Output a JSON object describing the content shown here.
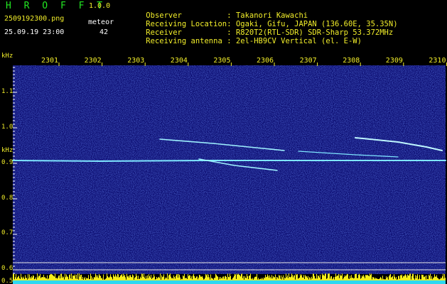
{
  "header": {
    "title": "H R O F F T",
    "version": "1.0.0",
    "filename": "2509192300.png",
    "datetime": "25.09.19 23:00",
    "meteor_label": "meteor",
    "meteor_count": "42"
  },
  "info": [
    {
      "label": "Observer",
      "value": ": Takanori Kawachi"
    },
    {
      "label": "Receiving Location",
      "value": ": Ogaki, Gifu, JAPAN (136.60E, 35.35N)"
    },
    {
      "label": "Receiver",
      "value": ": R820T2(RTL-SDR) SDR-Sharp 53.372MHz"
    },
    {
      "label": "Receiving antenna",
      "value": ": 2el-HB9CV Vertical (el. E-W)"
    }
  ],
  "axes": {
    "y_unit": "kHz",
    "y_ticks": [
      "1.1",
      "1.0",
      "0.9",
      "0.8",
      "0.7",
      "0.6"
    ],
    "y_ticks_lower": [
      "0.5"
    ],
    "x_ticks": [
      "2301",
      "2302",
      "2303",
      "2304",
      "2305",
      "2306",
      "2307",
      "2308",
      "2309",
      "2310"
    ]
  },
  "colors": {
    "text_green": "#22e822",
    "text_white": "#ffffff",
    "text_yellow": "#f2ee2a",
    "spectrogram_bg": "#0a0a6e",
    "signal": "#9ff3ff",
    "level_bar": "#f5ee1a"
  }
}
